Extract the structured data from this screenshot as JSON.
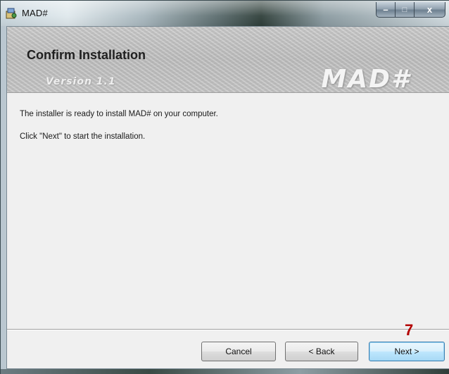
{
  "window": {
    "title": "MAD#",
    "icon": "installer-app-icon",
    "controls": {
      "minimize": "–",
      "maximize": "□",
      "close": "x"
    }
  },
  "banner": {
    "title": "Confirm Installation",
    "version": "Version 1.1",
    "logo": "MAD#"
  },
  "content": {
    "line1": "The installer is ready to install MAD# on your computer.",
    "line2": "Click \"Next\" to start the installation."
  },
  "buttons": {
    "cancel": "Cancel",
    "back": "< Back",
    "next": "Next >"
  },
  "annotation": {
    "step_number": "7"
  },
  "colors": {
    "client_bg": "#f0f0f0",
    "next_button_border": "#3c7fb1",
    "annotation": "#b30000"
  }
}
